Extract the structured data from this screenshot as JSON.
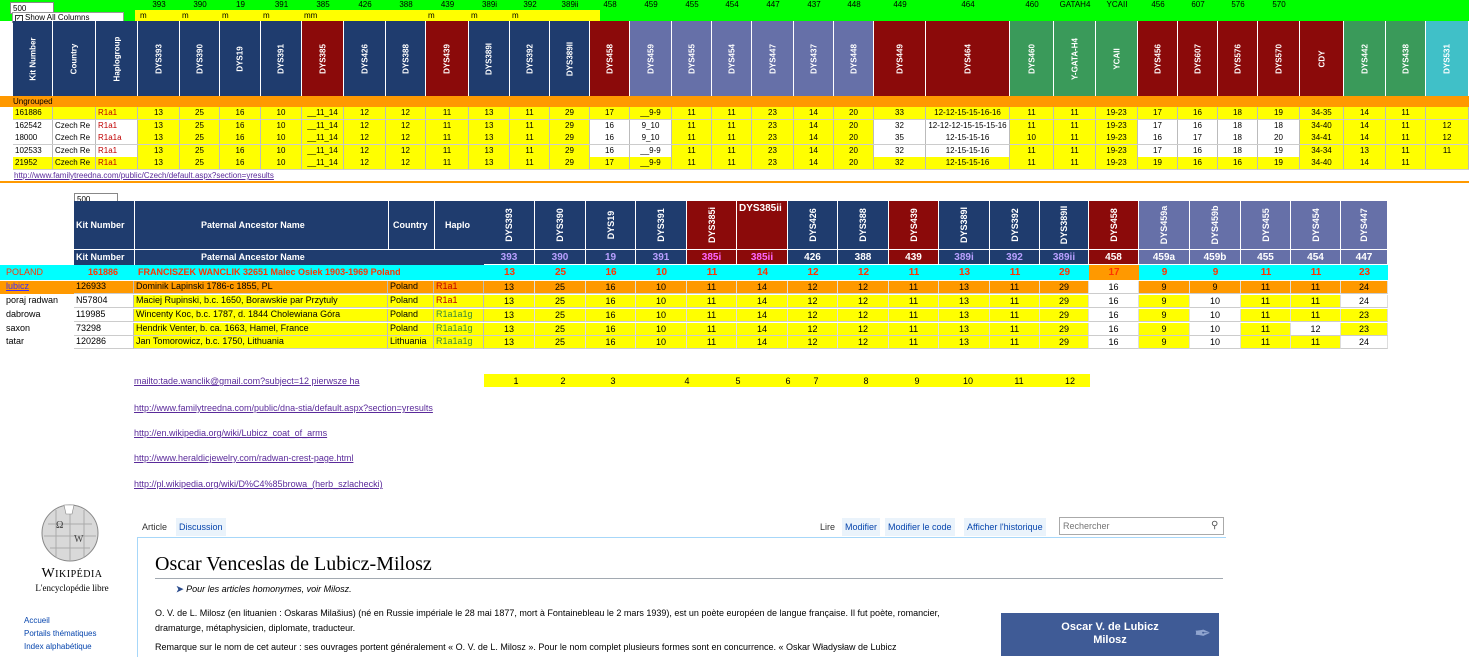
{
  "top": {
    "field_500": "500",
    "show_all": "Show All Columns",
    "marker_numbers": [
      "393",
      "390",
      "19",
      "391",
      "385",
      "426",
      "388",
      "439",
      "389i",
      "392",
      "389ii",
      "458",
      "459",
      "455",
      "454",
      "447",
      "437",
      "448",
      "449",
      "464",
      "460",
      "GATAH4",
      "YCAII",
      "456",
      "607",
      "576",
      "570"
    ],
    "units": [
      "m",
      "m",
      "m",
      "m",
      "mm",
      "m",
      "m",
      "m"
    ],
    "header_labels": [
      "Kit Number",
      "Country",
      "Haplogroup",
      "DYS393",
      "DYS390",
      "DYS19",
      "DYS391",
      "DYS385",
      "DYS426",
      "DYS388",
      "DYS439",
      "DYS389I",
      "DYS392",
      "DYS389II",
      "DYS458",
      "DYS459",
      "DYS455",
      "DYS454",
      "DYS447",
      "DYS437",
      "DYS448",
      "DYS449",
      "DYS464",
      "DYS460",
      "Y-GATA-H4",
      "YCAII",
      "DYS456",
      "DYS607",
      "DYS576",
      "DYS570",
      "CDY",
      "DYS442",
      "DYS438",
      "DYS531"
    ],
    "group_label": "Ungrouped",
    "rows": [
      [
        "161886",
        "",
        "R1a1",
        "13",
        "25",
        "16",
        "10",
        "__11_14",
        "12",
        "12",
        "11",
        "13",
        "11",
        "29",
        "17",
        "__9-9",
        "11",
        "11",
        "23",
        "14",
        "20",
        "33",
        "12-12-15-15-16-16",
        "11",
        "11",
        "19-23",
        "17",
        "16",
        "18",
        "19",
        "34-35",
        "14",
        "11",
        ""
      ],
      [
        "162542",
        "Czech Re",
        "R1a1",
        "13",
        "25",
        "16",
        "10",
        "__11_14",
        "12",
        "12",
        "11",
        "13",
        "11",
        "29",
        "16",
        "9_10",
        "11",
        "11",
        "23",
        "14",
        "20",
        "32",
        "12-12-12-15-15-15-16",
        "11",
        "11",
        "19-23",
        "17",
        "16",
        "18",
        "18",
        "34-40",
        "14",
        "11",
        "12"
      ],
      [
        "18000",
        "Czech Re",
        "R1a1a",
        "13",
        "25",
        "16",
        "10",
        "__11_14",
        "12",
        "12",
        "11",
        "13",
        "11",
        "29",
        "16",
        "9_10",
        "11",
        "11",
        "23",
        "14",
        "20",
        "35",
        "12-15-15-16",
        "10",
        "11",
        "19-23",
        "16",
        "17",
        "18",
        "20",
        "34-41",
        "14",
        "11",
        "12"
      ],
      [
        "102533",
        "Czech Re",
        "R1a1",
        "13",
        "25",
        "16",
        "10",
        "__11_14",
        "12",
        "12",
        "11",
        "13",
        "11",
        "29",
        "16",
        "__9-9",
        "11",
        "11",
        "23",
        "14",
        "20",
        "32",
        "12-15-15-16",
        "11",
        "11",
        "19-23",
        "17",
        "16",
        "18",
        "19",
        "34-34",
        "13",
        "11",
        "11"
      ],
      [
        "21952",
        "Czech Re",
        "R1a1",
        "13",
        "25",
        "16",
        "10",
        "__11_14",
        "12",
        "12",
        "11",
        "13",
        "11",
        "29",
        "17",
        "__9-9",
        "11",
        "11",
        "23",
        "14",
        "20",
        "32",
        "12-15-15-16",
        "11",
        "11",
        "19-23",
        "19",
        "16",
        "16",
        "19",
        "34-40",
        "14",
        "11",
        ""
      ]
    ],
    "url": "http://www.familytreedna.com/public/Czech/default.aspx?section=yresults"
  },
  "mid": {
    "field_500": "500",
    "headers": [
      "Kit Number",
      "Paternal Ancestor Name",
      "Country",
      "Haplo"
    ],
    "dys_labels": [
      "DYS393",
      "DYS390",
      "DYS19",
      "DYS391",
      "DYS385i",
      "DYS385ii",
      "DYS426",
      "DYS388",
      "DYS439",
      "DYS389I",
      "DYS392",
      "DYS389II",
      "DYS458",
      "DYS459a",
      "DYS459b",
      "DYS455",
      "DYS454",
      "DYS447"
    ],
    "sub_headers": [
      "Kit Number",
      "Paternal Ancestor Name"
    ],
    "marker_nums": [
      "393",
      "390",
      "19",
      "391",
      "385i",
      "385ii",
      "426",
      "388",
      "439",
      "389i",
      "392",
      "389ii",
      "458",
      "459a",
      "459b",
      "455",
      "454",
      "447"
    ],
    "poland": {
      "name": "POLAND",
      "kit": "161886",
      "ancestor": "FRANCISZEK WANCLIK  32651 Malec Osiek 1903-1969  Poland",
      "values": [
        "13",
        "25",
        "16",
        "10",
        "11",
        "14",
        "12",
        "12",
        "11",
        "13",
        "11",
        "29",
        "17",
        "9",
        "9",
        "11",
        "11",
        "23"
      ]
    },
    "rows": [
      {
        "label": "lubicz",
        "kit": "126933",
        "ancestor": "Dominik Lapinski 1786-c 1855, PL",
        "country": "Poland",
        "haplo": "R1a1",
        "values": [
          "13",
          "25",
          "16",
          "10",
          "11",
          "14",
          "12",
          "12",
          "11",
          "13",
          "11",
          "29",
          "16",
          "9",
          "9",
          "11",
          "11",
          "24"
        ]
      },
      {
        "label": "poraj radwan",
        "kit": "N57804",
        "ancestor": "Maciej Rupinski, b.c. 1650, Borawskie par Przytuly",
        "country": "Poland",
        "haplo": "R1a1",
        "values": [
          "13",
          "25",
          "16",
          "10",
          "11",
          "14",
          "12",
          "12",
          "11",
          "13",
          "11",
          "29",
          "16",
          "9",
          "10",
          "11",
          "11",
          "24"
        ]
      },
      {
        "label": "dabrowa",
        "kit": "119985",
        "ancestor": "Wincenty Koc, b.c. 1787, d. 1844 Cholewiana Góra",
        "country": "Poland",
        "haplo": "R1a1a1g",
        "values": [
          "13",
          "25",
          "16",
          "10",
          "11",
          "14",
          "12",
          "12",
          "11",
          "13",
          "11",
          "29",
          "16",
          "9",
          "10",
          "11",
          "11",
          "23"
        ]
      },
      {
        "label": "saxon",
        "kit": "73298",
        "ancestor": "Hendrik Venter, b. ca. 1663, Hamel, France",
        "country": "Poland",
        "haplo": "R1a1a1g",
        "values": [
          "13",
          "25",
          "16",
          "10",
          "11",
          "14",
          "12",
          "12",
          "11",
          "13",
          "11",
          "29",
          "16",
          "9",
          "10",
          "11",
          "12",
          "23"
        ]
      },
      {
        "label": "tatar",
        "kit": "120286",
        "ancestor": "Jan Tomorowicz, b.c. 1750, Lithuania",
        "country": "Lithuania",
        "haplo": "R1a1a1g",
        "values": [
          "13",
          "25",
          "16",
          "10",
          "11",
          "14",
          "12",
          "12",
          "11",
          "13",
          "11",
          "29",
          "16",
          "9",
          "10",
          "11",
          "11",
          "24"
        ]
      }
    ]
  },
  "links": {
    "mailto": "mailto:tade.wanclik@gmail.com?subject=12 pierwsze ha",
    "counters": [
      "1",
      "2",
      "3",
      "4",
      "5",
      "6",
      "7",
      "8",
      "9",
      "10",
      "11",
      "12"
    ],
    "urls": [
      "http://www.familytreedna.com/public/dna-stia/default.aspx?section=yresults",
      "http://en.wikipedia.org/wiki/Lubicz_coat_of_arms",
      "http://www.heraldicjewelry.com/radwan-crest-page.html",
      "http://pl.wikipedia.org/wiki/D%C4%85browa_(herb_szlachecki)"
    ]
  },
  "wiki": {
    "logo_title": "Wikipédia",
    "logo_sub": "L'encyclopédie libre",
    "tabs": [
      "Article",
      "Discussion"
    ],
    "actions": [
      "Lire",
      "Modifier",
      "Modifier le code",
      "Afficher l'historique"
    ],
    "search_placeholder": "Rechercher",
    "title": "Oscar Venceslas de Lubicz-Milosz",
    "hatnote": "Pour les articles homonymes, voir Milosz.",
    "p1": "O. V. de L. Milosz (en lituanien : Oskaras Milašius) (né en Russie impériale le 28 mai 1877, mort à Fontainebleau le 2 mars 1939), est un poète européen de langue française. Il fut poète, romancier, dramaturge, métaphysicien, diplomate, traducteur.",
    "p2": "Remarque sur le nom de cet auteur : ses ouvrages portent généralement « O. V. de L. Milosz ». Pour le nom complet plusieurs formes sont en concurrence. « Oskar Władysław de Lubicz",
    "sidebar": [
      "Accueil",
      "Portails thématiques",
      "Index alphabétique"
    ],
    "infobox_title": "Oscar V. de Lubicz Milosz"
  }
}
